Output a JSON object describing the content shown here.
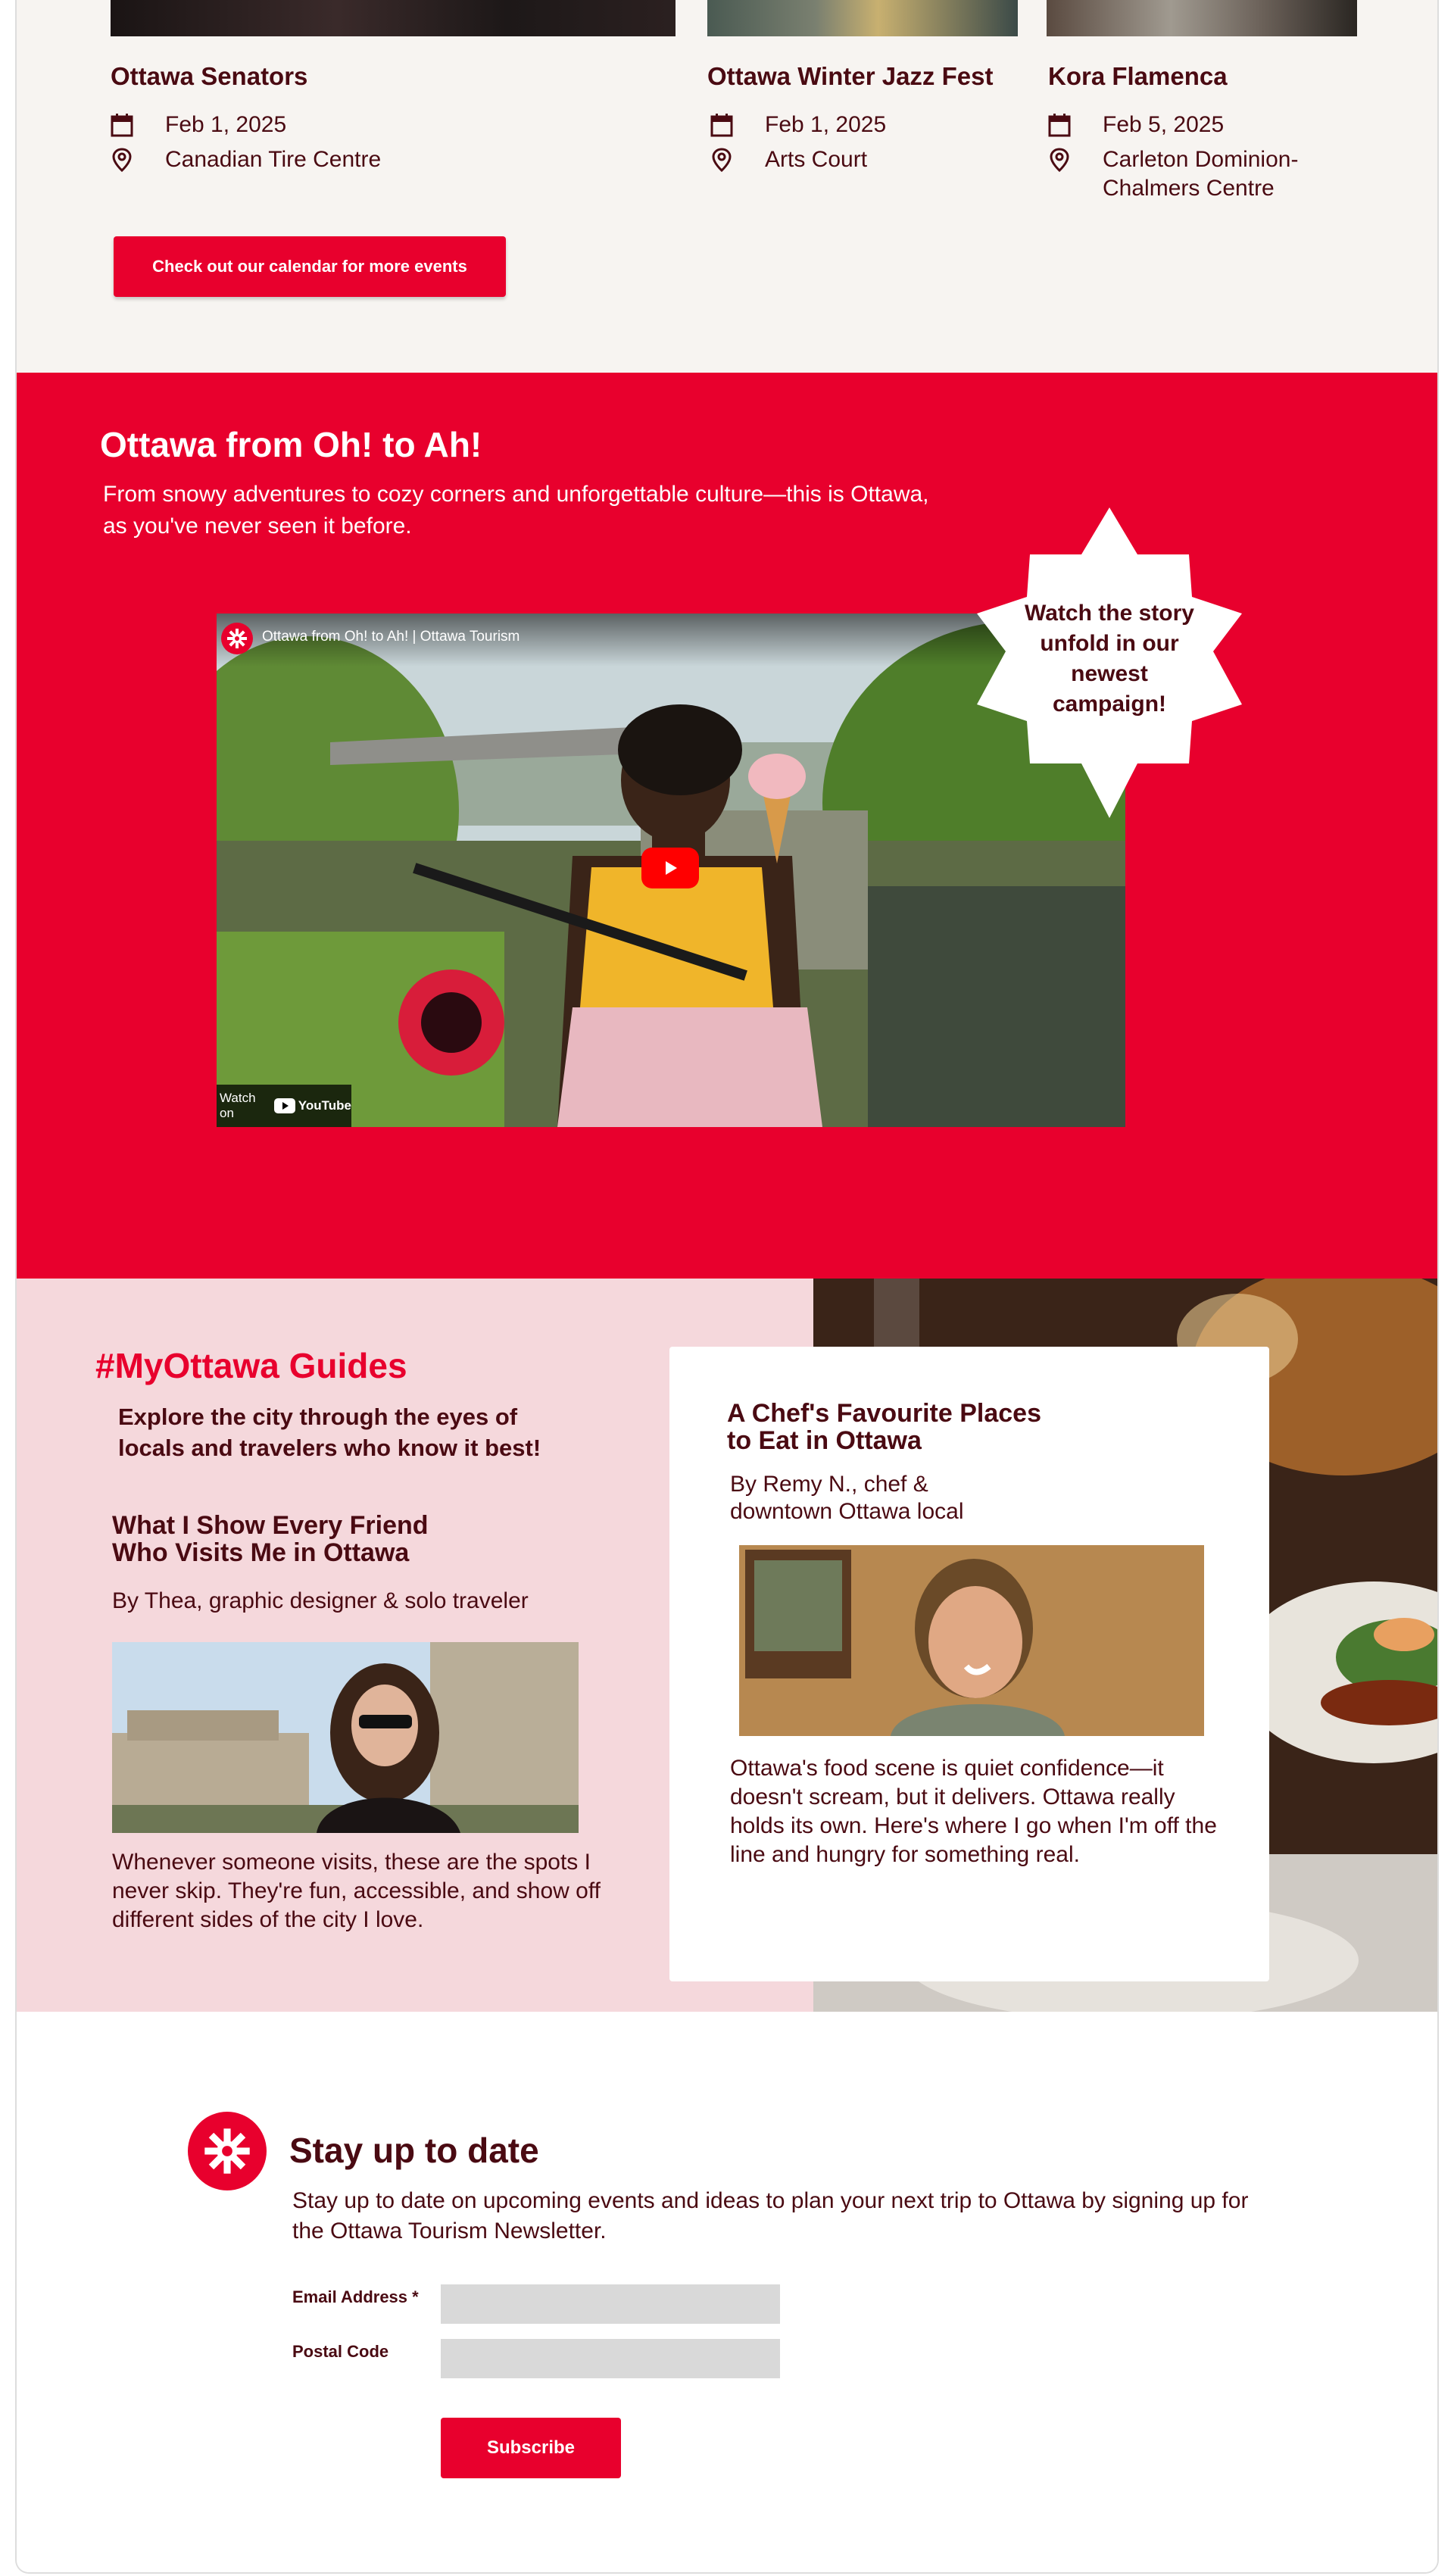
{
  "events": {
    "items": [
      {
        "title": "Ottawa Senators",
        "date": "Feb 1, 2025",
        "venue": "Canadian Tire Centre"
      },
      {
        "title": "Ottawa Winter Jazz Fest",
        "date": "Feb 1, 2025",
        "venue": "Arts Court"
      },
      {
        "title": "Kora Flamenca",
        "date": "Feb 5, 2025",
        "venue_line1": "Carleton Dominion-",
        "venue_line2": "Chalmers Centre"
      }
    ],
    "calendar_button": "Check out our calendar for more events"
  },
  "campaign": {
    "title": "Ottawa from Oh! to Ah!",
    "subtitle": "From snowy adventures to cozy corners and unforgettable culture—this is Ottawa, as you've never seen it before.",
    "video_title": "Ottawa from Oh! to Ah! | Ottawa Tourism",
    "watch_on": "Watch on",
    "youtube": "YouTube",
    "starburst": "Watch the story unfold in our newest campaign!"
  },
  "guides": {
    "heading": "#MyOttawa Guides",
    "subheading": "Explore the city through the eyes of locals and travelers who know it best!",
    "left": {
      "title_line1": "What I Show Every Friend",
      "title_line2": "Who Visits Me in Ottawa",
      "byline": "By Thea, graphic designer & solo traveler",
      "description": "Whenever someone visits, these are the spots I never skip. They're fun, accessible, and show off different sides of the city I love."
    },
    "card": {
      "title_line1": "A Chef's Favourite Places",
      "title_line2": "to Eat in Ottawa",
      "byline_line1": "By Remy N., chef &",
      "byline_line2": "downtown Ottawa local",
      "description": "Ottawa's food scene is quiet confidence—it doesn't scream, but it delivers. Ottawa really holds its own. Here's where I go when I'm off the line and hungry for something real."
    }
  },
  "newsletter": {
    "title": "Stay up to date",
    "description": "Stay up to date on upcoming events and ideas to plan your next trip to Ottawa by signing up for the Ottawa Tourism Newsletter.",
    "email_label": "Email Address",
    "required_mark": "*",
    "postal_label": "Postal Code",
    "email_value": "",
    "postal_value": "",
    "subscribe_button": "Subscribe"
  },
  "colors": {
    "brand_red": "#e8002d",
    "text_maroon": "#4a0a12",
    "events_bg": "#f7f4f1",
    "guides_bg": "#f5d8dc",
    "input_bg": "#d9d9d9"
  },
  "icons": [
    "calendar-icon",
    "location-pin-icon",
    "ottawa-logo-icon",
    "play-icon",
    "youtube-logo-icon"
  ]
}
